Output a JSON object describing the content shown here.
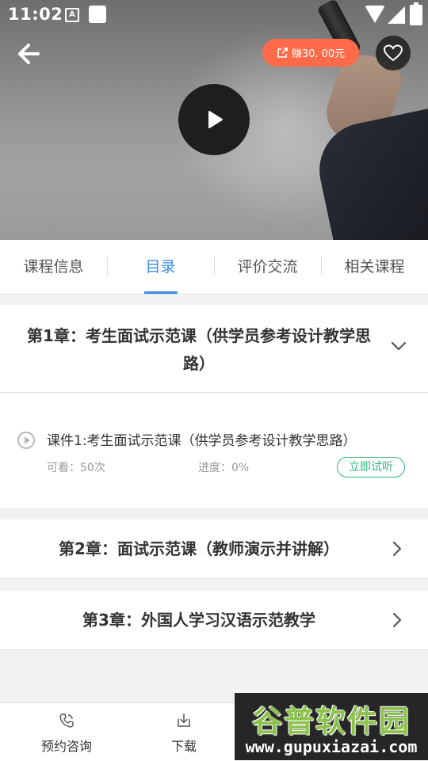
{
  "status_bar": {
    "time": "11:02",
    "notification_letter": "A"
  },
  "header": {
    "earn_label": "赚30. 00元"
  },
  "tabs": [
    {
      "label": "课程信息",
      "active": false
    },
    {
      "label": "目录",
      "active": true
    },
    {
      "label": "评价交流",
      "active": false
    },
    {
      "label": "相关课程",
      "active": false
    }
  ],
  "chapters": [
    {
      "title": "第1章：考生面试示范课（供学员参考设计教学思路）",
      "expanded": true,
      "lessons": [
        {
          "title": "课件1:考生面试示范课（供学员参考设计教学思路）",
          "views": "可看：50次",
          "progress": "进度：0%",
          "action": "立即试听"
        }
      ]
    },
    {
      "title": "第2章：面试示范课（教师演示并讲解）",
      "expanded": false
    },
    {
      "title": "第3章：外国人学习汉语示范教学",
      "expanded": false
    }
  ],
  "bottom_bar": [
    {
      "label": "预约咨询",
      "icon": "phone-icon"
    },
    {
      "label": "下载",
      "icon": "download-icon"
    }
  ],
  "watermark": {
    "title": "谷普软件园",
    "url": "www.gupuxiazai.com"
  },
  "colors": {
    "accent": "#3a8ee6",
    "earn": "#ff6b4a",
    "trial": "#2db87d"
  }
}
